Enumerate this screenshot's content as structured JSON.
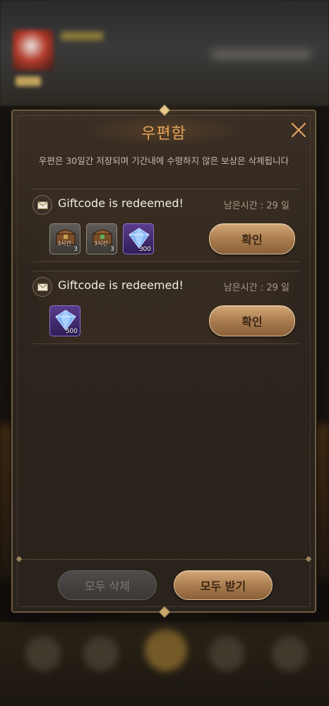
{
  "mailbox": {
    "title": "우편함",
    "notice": "우편은 30일간 저장되며 기간내에 수령하지 않은 보상은 삭제됩니다",
    "items": [
      {
        "title": "Giftcode is redeemed!",
        "remaining": "남은시간 : 29 일",
        "rewards": [
          {
            "icon": "time-chest-icon",
            "label": "3시간",
            "qty": "3"
          },
          {
            "icon": "time-chest-icon",
            "label": "3시간",
            "qty": "3"
          },
          {
            "icon": "diamond-icon",
            "qty": "300"
          }
        ],
        "confirm_label": "확인"
      },
      {
        "title": "Giftcode is redeemed!",
        "remaining": "남은시간 : 29 일",
        "rewards": [
          {
            "icon": "diamond-icon",
            "qty": "500"
          }
        ],
        "confirm_label": "확인"
      }
    ],
    "delete_all_label": "모두 삭제",
    "receive_all_label": "모두 받기"
  },
  "colors": {
    "title": "#e4a35c",
    "button_gold": "#b8885a",
    "panel_bg": "#2d251d"
  }
}
